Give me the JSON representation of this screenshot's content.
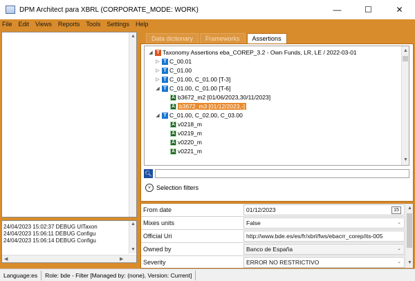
{
  "window": {
    "title": "DPM Architect para XBRL (CORPORATE_MODE: WORK)",
    "minimize": "—",
    "maximize": "☐",
    "close": "✕"
  },
  "menu": [
    "File",
    "Edit",
    "Views",
    "Reports",
    "Tools",
    "Settings",
    "Help"
  ],
  "tabs": [
    {
      "label": "Data dictionary",
      "active": false
    },
    {
      "label": "Frameworks",
      "active": false
    },
    {
      "label": "Assertions",
      "active": true
    }
  ],
  "tree": {
    "root": "Taxonomy Assertions eba_COREP_3.2 - Own Funds, LR, LE  / 2022-03-01",
    "nodes": [
      {
        "label": "C_00.01",
        "icon": "T",
        "expander": "▷"
      },
      {
        "label": "C_01.00",
        "icon": "T",
        "expander": "▷"
      },
      {
        "label": "C_01.00, C_01.00 [T-3]",
        "icon": "T",
        "expander": "▷"
      },
      {
        "label": "C_01.00, C_01.00 [T-6]",
        "icon": "T",
        "expander": "◢"
      },
      {
        "label": "b3672_m2 [01/06/2023,30/11/2023]",
        "icon": "A",
        "expander": ""
      },
      {
        "label": "b3672_m3 [01/12/2023,-]",
        "icon": "A",
        "expander": "",
        "selected": true
      },
      {
        "label": "C_01.00, C_02.00, C_03.00",
        "icon": "T",
        "expander": "◢"
      },
      {
        "label": "v0218_m",
        "icon": "A",
        "expander": ""
      },
      {
        "label": "v0219_m",
        "icon": "A",
        "expander": ""
      },
      {
        "label": "v0220_m",
        "icon": "A",
        "expander": ""
      },
      {
        "label": "v0221_m",
        "icon": "A",
        "expander": ""
      }
    ]
  },
  "search": {
    "value": "",
    "icon": "search-icon"
  },
  "selection_filters": "Selection filters",
  "properties": [
    {
      "name": "From date",
      "value": "01/12/2023",
      "control": "calendar",
      "control_label": "15"
    },
    {
      "name": "Mixes units",
      "value": "False",
      "control": "dropdown"
    },
    {
      "name": "Official Uri",
      "value": "http://www.bde.es/es/fr/xbrl/fws/ebacrr_corep/its-005",
      "control": "none"
    },
    {
      "name": "Owned by",
      "value": "Banco de España",
      "control": "dropdown"
    },
    {
      "name": "Severity",
      "value": "ERROR NO RESTRICTIVO",
      "control": "dropdown"
    }
  ],
  "log": [
    "24/04/2023 15:02:37 DEBUG UITaxon",
    "24/04/2023 15:06:11 DEBUG Configu",
    "24/04/2023 15:06:14 DEBUG Configu"
  ],
  "status": {
    "language": "Language:es",
    "role": "Role: bde - Filter [Managed by: (none), Version: Current]"
  },
  "colors": {
    "accent": "#d98c2b",
    "selection": "#e88a2e",
    "table_icon": "#1976d2",
    "assertion_icon": "#1b5e20"
  }
}
